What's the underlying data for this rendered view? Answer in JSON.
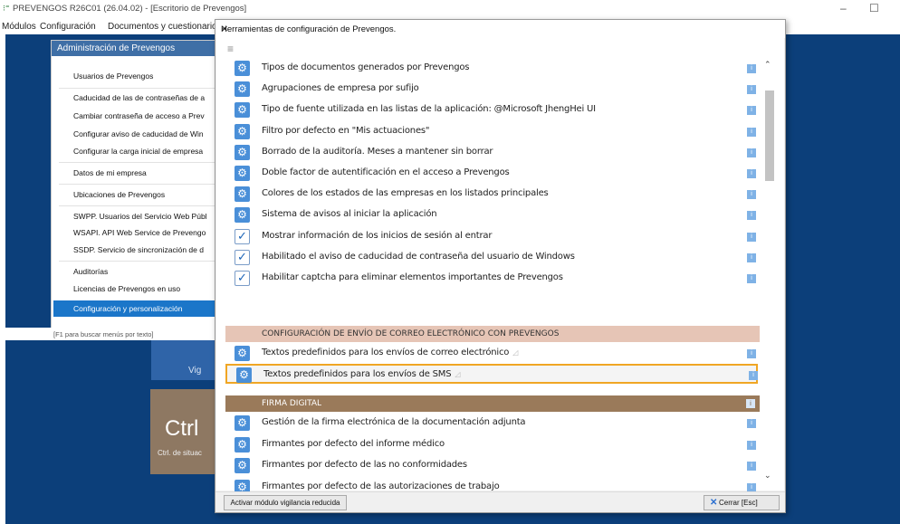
{
  "window": {
    "title": "PREVENGOS R26C01 (26.04.02) - [Escritorio de Prevengos]",
    "minimize": "–",
    "maximize": "☐"
  },
  "menubar": [
    "Módulos",
    "Configuración",
    "Documentos y cuestionarios"
  ],
  "admin_panel": {
    "title": "Administración de Prevengos",
    "items": [
      "Usuarios de Prevengos",
      "Caducidad de las de contraseñas de a",
      "Cambiar contraseña de acceso a Prev",
      "Configurar aviso de caducidad de Win",
      "Configurar la carga inicial de empresa",
      "Datos de mi empresa",
      "Ubicaciones de Prevengos",
      "SWPP. Usuarios del Servicio Web Públ",
      "WSAPI. API Web Service de Prevengo",
      "SSDP. Servicio de sincronización de d",
      "Auditorías",
      "Licencias de Prevengos en uso"
    ],
    "selected": "Configuración y personalización",
    "footer": "[F1 para buscar menús por texto]"
  },
  "tiles": {
    "blue_text": "Vig",
    "brown_big": "Ctrl",
    "brown_small": "Ctrl. de situac"
  },
  "dialog": {
    "title": "Herramientas de configuración de Prevengos.",
    "close": "✕",
    "hamburger": "≡",
    "rows": [
      {
        "icon": "gear",
        "label": "Tipos de documentos generados por Prevengos"
      },
      {
        "icon": "gear",
        "label": "Agrupaciones de empresa por sufijo"
      },
      {
        "icon": "gear",
        "label": "Tipo de fuente utilizada en las listas de la aplicación: @Microsoft JhengHei UI"
      },
      {
        "icon": "gear",
        "label": "Filtro por defecto en \"Mis actuaciones\""
      },
      {
        "icon": "gear",
        "label": "Borrado de la auditoría. Meses a mantener sin borrar"
      },
      {
        "icon": "gear",
        "label": "Doble factor de autentificación en el acceso a Prevengos"
      },
      {
        "icon": "gear",
        "label": "Colores de los estados de las empresas en los listados principales"
      },
      {
        "icon": "gear",
        "label": "Sistema de avisos al iniciar la aplicación"
      },
      {
        "icon": "check",
        "label": "Mostrar información de los inicios de sesión al entrar"
      },
      {
        "icon": "check",
        "label": "Habilitado el aviso de caducidad de contraseña del usuario de Windows"
      },
      {
        "icon": "check",
        "label": "Habilitar captcha para eliminar elementos importantes de Prevengos"
      }
    ],
    "section_email": "CONFIGURACIÓN DE ENVÍO DE CORREO ELECTRÓNICO CON PREVENGOS",
    "email_rows": [
      {
        "icon": "gear",
        "label": "Textos predefinidos para los envíos de correo electrónico"
      },
      {
        "icon": "gear",
        "label": "Textos predefinidos para los envíos de SMS"
      }
    ],
    "section_firma": "FIRMA DIGITAL",
    "firma_rows": [
      {
        "icon": "gear",
        "label": "Gestión de la firma electrónica de la documentación adjunta"
      },
      {
        "icon": "gear",
        "label": "Firmantes por defecto del informe médico"
      },
      {
        "icon": "gear",
        "label": "Firmantes por defecto de las no conformidades"
      },
      {
        "icon": "gear",
        "label": "Firmantes por defecto de las autorizaciones de trabajo"
      }
    ],
    "info_glyph": "i",
    "note_glyph": "◿",
    "btn_vigilancia": "Activar módulo vigilancia reducida",
    "btn_cerrar": "Cerrar [Esc]"
  },
  "colors": {
    "desktop": "#0c3f7a",
    "panel_header": "#3f6fa6",
    "selected": "#1b76c9",
    "section_email": "#e6c5b6",
    "section_firma": "#9a7a5a",
    "highlight": "#f0a624"
  }
}
